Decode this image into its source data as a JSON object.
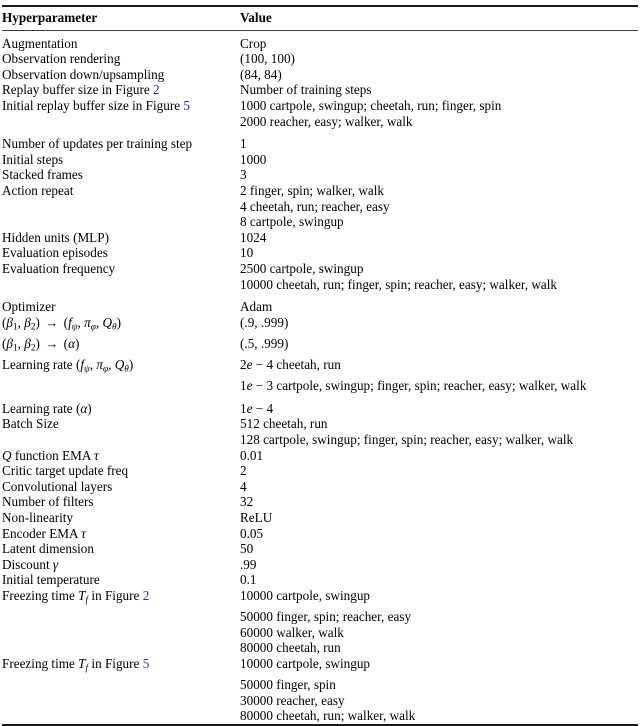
{
  "document": {
    "type": "academic-table",
    "header": {
      "col_name": "Hyperparameter",
      "col_value": "Value"
    },
    "link_color": "#2a2ad0",
    "rows": [
      {
        "name_html": "Augmentation",
        "values": [
          "Crop"
        ]
      },
      {
        "name_html": "Observation rendering",
        "values": [
          "(100, 100)"
        ]
      },
      {
        "name_html": "Observation down/upsampling",
        "values": [
          "(84, 84)"
        ]
      },
      {
        "name_html": "Replay buffer size in Figure <span class=\"ref\">2</span>",
        "values": [
          "Number of training steps"
        ]
      },
      {
        "name_html": "Initial replay buffer size in Figure <span class=\"ref\">5</span>",
        "values": [
          "1000 cartpole, swingup; cheetah, run; finger, spin",
          "2000 reacher, easy; walker, walk"
        ]
      },
      {
        "gap": true
      },
      {
        "name_html": "Number of updates per training step",
        "values": [
          "1"
        ]
      },
      {
        "name_html": "Initial steps",
        "values": [
          "1000"
        ]
      },
      {
        "name_html": "Stacked frames",
        "values": [
          "3"
        ]
      },
      {
        "name_html": "Action repeat",
        "values": [
          "2 finger, spin; walker, walk",
          "4 cheetah, run; reacher, easy",
          "8 cartpole, swingup"
        ]
      },
      {
        "name_html": "Hidden units (MLP)",
        "values": [
          "1024"
        ]
      },
      {
        "name_html": "Evaluation episodes",
        "values": [
          "10"
        ]
      },
      {
        "name_html": "Evaluation frequency",
        "values": [
          "2500 cartpole, swingup",
          "10000 cheetah, run; finger, spin; reacher, easy; walker, walk"
        ]
      },
      {
        "gap": true
      },
      {
        "name_html": "Optimizer",
        "values": [
          "Adam"
        ]
      },
      {
        "name_html": "(<i class=\"mi\">&beta;</i><span class=\"subn\">1</span>, <i class=\"mi\">&beta;</i><span class=\"subn\">2</span>) <span class=\"arrow\">&rarr;</span> (<i class=\"mi\">f</i><span class=\"sub\">&psi;</span>, <i class=\"mi\">&pi;</i><span class=\"sub\">&phi;</span>, <i class=\"mi\">Q</i><span class=\"sub\">&theta;</span>)",
        "values": [
          "(.9, .999)"
        ]
      },
      {
        "name_html": "(<i class=\"mi\">&beta;</i><span class=\"subn\">1</span>, <i class=\"mi\">&beta;</i><span class=\"subn\">2</span>) <span class=\"arrow\">&rarr;</span> (<i class=\"mi\">&alpha;</i>)",
        "values": [
          "(.5, .999)"
        ]
      },
      {
        "name_html": "Learning rate (<i class=\"mi\">f</i><span class=\"sub\">&psi;</span>, <i class=\"mi\">&pi;</i><span class=\"sub\">&phi;</span>, <i class=\"mi\">Q</i><span class=\"sub\">&theta;</span>)",
        "values": [
          "2<i class=\"mi\">e</i> &minus; 4 cheetah, run",
          "1<i class=\"mi\">e</i> &minus; 3 cartpole, swingup; finger, spin; reacher, easy; walker, walk"
        ]
      },
      {
        "gap": true
      },
      {
        "name_html": "Learning rate (<i class=\"mi\">&alpha;</i>)",
        "values": [
          "1<i class=\"mi\">e</i> &minus; 4"
        ]
      },
      {
        "name_html": "Batch Size",
        "values": [
          "512 cheetah, run",
          "128 cartpole, swingup; finger, spin; reacher, easy; walker, walk"
        ]
      },
      {
        "name_html": "<i class=\"mi\">Q</i> function EMA <i class=\"mi\">&tau;</i>",
        "values": [
          "0.01"
        ]
      },
      {
        "name_html": "Critic target update freq",
        "values": [
          "2"
        ]
      },
      {
        "name_html": "Convolutional layers",
        "values": [
          "4"
        ]
      },
      {
        "name_html": "Number of filters",
        "values": [
          "32"
        ]
      },
      {
        "name_html": "Non-linearity",
        "values": [
          "ReLU"
        ]
      },
      {
        "name_html": "Encoder EMA <i class=\"mi\">&tau;</i>",
        "values": [
          "0.05"
        ]
      },
      {
        "name_html": "Latent dimension",
        "values": [
          "50"
        ]
      },
      {
        "name_html": "Discount <i class=\"mi\">&gamma;</i>",
        "values": [
          ".99"
        ]
      },
      {
        "name_html": "Initial temperature",
        "values": [
          "0.1"
        ]
      },
      {
        "name_html": "Freezing time <i class=\"mi\">T</i><span class=\"sub\">f</span> in Figure <span class=\"ref\">2</span>",
        "values": [
          "10000 cartpole, swingup",
          "50000 finger, spin; reacher, easy",
          "60000 walker, walk",
          "80000 cheetah, run"
        ]
      },
      {
        "name_html": "Freezing time <i class=\"mi\">T</i><span class=\"sub\">f</span> in Figure <span class=\"ref\">5</span>",
        "values": [
          "10000 cartpole, swingup",
          "50000 finger, spin",
          "30000 reacher, easy",
          "80000 cheetah, run; walker, walk"
        ]
      }
    ]
  }
}
